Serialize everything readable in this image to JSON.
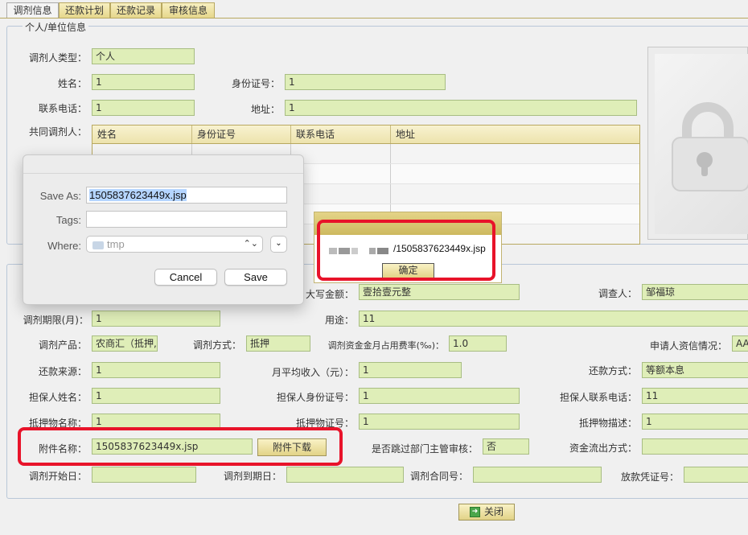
{
  "tabs": [
    "调剂信息",
    "还款计划",
    "还款记录",
    "审核信息"
  ],
  "section1": {
    "legend": "个人/单位信息",
    "type_label": "调剂人类型：",
    "type_value": "个人",
    "name_label": "姓名：",
    "name_value": "1",
    "id_label": "身份证号：",
    "id_value": "1",
    "phone_label": "联系电话：",
    "phone_value": "1",
    "addr_label": "地址：",
    "addr_value": "1",
    "co_label": "共同调剂人：",
    "table_headers": [
      "姓名",
      "身份证号",
      "联系电话",
      "地址"
    ]
  },
  "section2": {
    "amount_label": "大写金额：",
    "amount_value": "壹拾壹元整",
    "investigator_label": "调查人：",
    "investigator_value": "邹福琼",
    "period_label": "调剂期限(月)：",
    "period_value": "1",
    "purpose_label": "用途：",
    "purpose_value": "11",
    "product_label": "调剂产品：",
    "product_value": "农商汇（抵押,",
    "method_label": "调剂方式：",
    "method_value": "抵押",
    "rate_label": "调剂资金金月占用费率(‰)：",
    "rate_value": "1.0",
    "credit_label": "申请人资信情况：",
    "credit_value": "AA",
    "source_label": "还款来源：",
    "source_value": "1",
    "income_label": "月平均收入（元）：",
    "income_value": "1",
    "repay_label": "还款方式：",
    "repay_value": "等额本息",
    "guarantor_label": "担保人姓名：",
    "guarantor_value": "1",
    "guarantor_id_label": "担保人身份证号：",
    "guarantor_id_value": "1",
    "guarantor_phone_label": "担保人联系电话：",
    "guarantor_phone_value": "11",
    "collateral_label": "抵押物名称：",
    "collateral_value": "1",
    "collateral_cert_label": "抵押物证号：",
    "collateral_cert_value": "1",
    "collateral_desc_label": "抵押物描述：",
    "collateral_desc_value": "1",
    "attach_label": "附件名称：",
    "attach_value": "1505837623449x.jsp",
    "attach_button": "附件下载",
    "skip_label": "是否跳过部门主管审核：",
    "skip_value": "否",
    "outflow_label": "资金流出方式：",
    "start_label": "调剂开始日：",
    "end_label": "调剂到期日：",
    "contract_label": "调剂合同号：",
    "voucher_label": "放款凭证号："
  },
  "close_button": "关闭",
  "save_dialog": {
    "save_as_label": "Save As:",
    "filename": "1505837623449x.jsp",
    "tags_label": "Tags:",
    "where_label": "Where:",
    "where_value": "tmp",
    "cancel": "Cancel",
    "save": "Save"
  },
  "alert": {
    "message": "/1505837623449x.jsp",
    "ok": "确定"
  },
  "colors": {
    "field_bg": "#dfeeb8",
    "highlight": "#e8132a"
  }
}
